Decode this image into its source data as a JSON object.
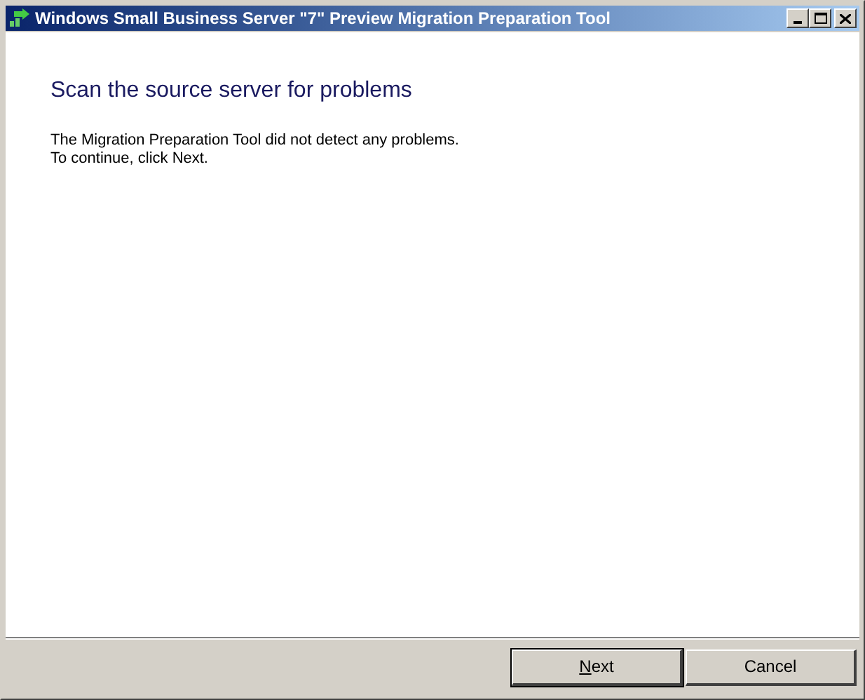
{
  "window": {
    "title": "Windows Small Business Server \"7\" Preview Migration Preparation Tool"
  },
  "heading": "Scan the source server for problems",
  "message": [
    "The Migration Preparation Tool did not detect any problems.",
    "To continue, click Next."
  ],
  "buttons": [
    {
      "label": "Next",
      "default": true
    },
    {
      "label": "Cancel",
      "default": false
    }
  ]
}
